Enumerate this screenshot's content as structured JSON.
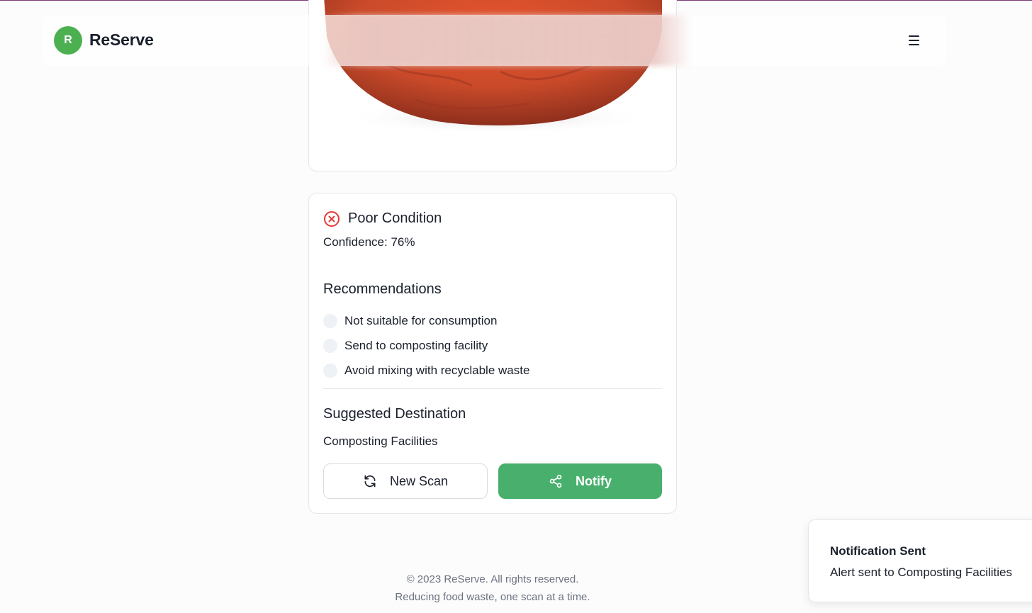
{
  "app": {
    "logo_letter": "R",
    "name": "ReServe"
  },
  "header": {
    "menu_icon": "hamburger-menu-icon"
  },
  "result": {
    "status_icon": "x-circle-icon",
    "status_color": "#e53935",
    "status": "Poor Condition",
    "confidence": "Confidence: 76%",
    "recommendations_title": "Recommendations",
    "recommendations": [
      "Not suitable for consumption",
      "Send to composting facility",
      "Avoid mixing with recyclable waste"
    ],
    "destination_title": "Suggested Destination",
    "destination": "Composting Facilities",
    "new_scan_label": "New Scan",
    "new_scan_icon": "refresh-icon",
    "notify_label": "Notify",
    "notify_icon": "share-icon",
    "accent_color": "#48b06c"
  },
  "footer": {
    "copyright": "© 2023 ReServe. All rights reserved.",
    "tagline": "Reducing food waste, one scan at a time."
  },
  "toast": {
    "title": "Notification Sent",
    "message": "Alert sent to Composting Facilities"
  }
}
